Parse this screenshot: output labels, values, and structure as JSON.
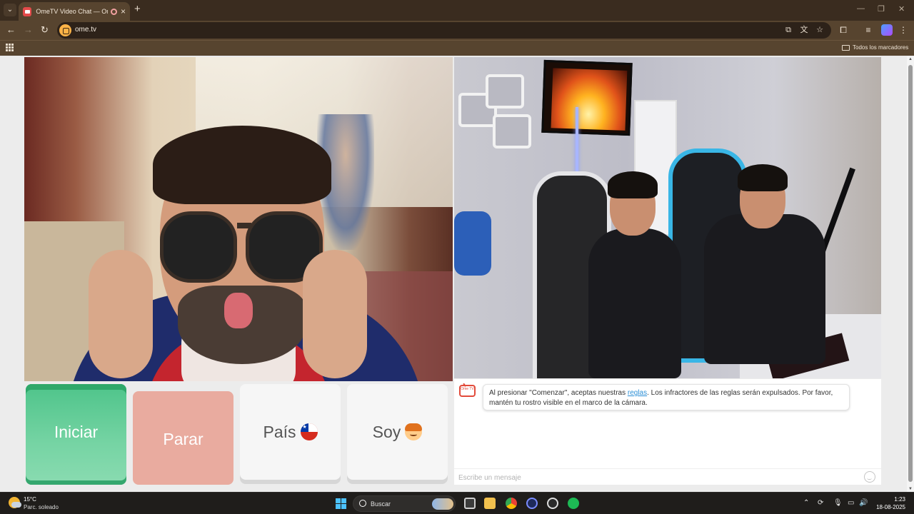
{
  "browser": {
    "tab": {
      "title": "OmeTV Video Chat — Ome"
    },
    "address": {
      "url": "ome.tv"
    },
    "bookmarks": {
      "all_label": "Todos los marcadores"
    }
  },
  "controls": {
    "start_label": "Iniciar",
    "stop_label": "Parar",
    "country_label": "País",
    "country_flag": "chile-flag",
    "gender_label": "Soy",
    "gender_icon": "boy-emoji"
  },
  "chat": {
    "logo_text": "Ome TV",
    "message_before": "Al presionar \"Comenzar\", aceptas nuestras ",
    "message_link": "reglas",
    "message_after": ". Los infractores de las reglas serán expulsados. Por favor, mantén tu rostro visible en el marco de la cámara.",
    "input_placeholder": "Escribe un mensaje"
  },
  "taskbar": {
    "weather_temp": "15°C",
    "weather_condition": "Parc. soleado",
    "search_label": "Buscar",
    "time": "1:23",
    "date": "18-08-2025"
  },
  "colors": {
    "start_green": "#4ec48a",
    "stop_red": "#e9ab9f",
    "chrome_brown": "#57442f",
    "link_blue": "#2b8fd6"
  }
}
